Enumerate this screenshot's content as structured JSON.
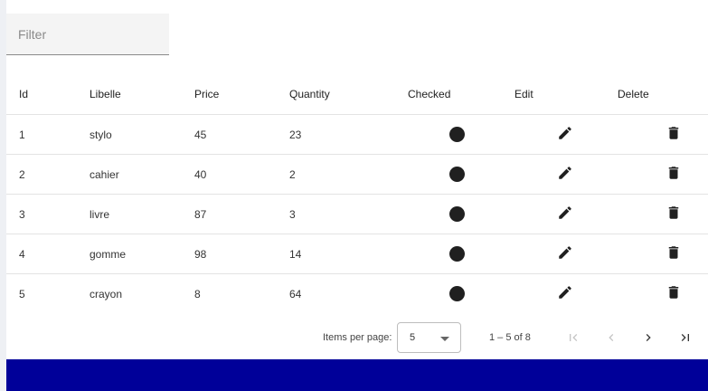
{
  "filter": {
    "placeholder": "Filter",
    "value": ""
  },
  "table": {
    "headers": {
      "id": "Id",
      "libelle": "Libelle",
      "price": "Price",
      "quantity": "Quantity",
      "checked": "Checked",
      "edit": "Edit",
      "delete": "Delete"
    },
    "rows": [
      {
        "id": "1",
        "libelle": "stylo",
        "price": "45",
        "quantity": "23"
      },
      {
        "id": "2",
        "libelle": "cahier",
        "price": "40",
        "quantity": "2"
      },
      {
        "id": "3",
        "libelle": "livre",
        "price": "87",
        "quantity": "3"
      },
      {
        "id": "4",
        "libelle": "gomme",
        "price": "98",
        "quantity": "14"
      },
      {
        "id": "5",
        "libelle": "crayon",
        "price": "8",
        "quantity": "64"
      }
    ],
    "icons": {
      "checked": "filled-circle-icon",
      "edit": "pencil-icon",
      "delete": "trash-icon"
    }
  },
  "paginator": {
    "items_per_page_label": "Items per page:",
    "page_size": "5",
    "range_label": "1 – 5 of 8",
    "icons": {
      "first": "first-page-icon",
      "prev": "chevron-left-icon",
      "next": "chevron-right-icon",
      "last": "last-page-icon"
    }
  },
  "colors": {
    "footer": "#000099",
    "icon": "#202020",
    "disabled_icon": "#c4c4c4"
  }
}
